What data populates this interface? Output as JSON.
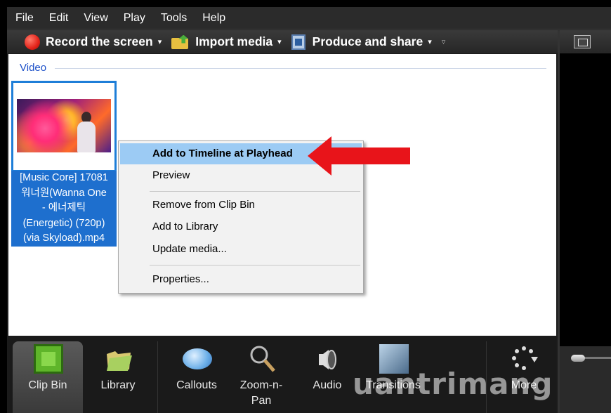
{
  "menubar": {
    "items": [
      "File",
      "Edit",
      "View",
      "Play",
      "Tools",
      "Help"
    ]
  },
  "toolbar": {
    "record_label": "Record the screen",
    "import_label": "Import media",
    "produce_label": "Produce and share",
    "caret": "▾",
    "more_caret": "▿"
  },
  "bin": {
    "section_title": "Video",
    "clip": {
      "label_lines": [
        "[Music Core] 17081",
        "워너원(Wanna One",
        "- 에너제틱",
        "(Energetic) (720p)",
        "(via Skyload).mp4"
      ]
    }
  },
  "context_menu": {
    "items": [
      "Add to Timeline at Playhead",
      "Preview",
      "Remove from Clip Bin",
      "Add to Library",
      "Update media...",
      "Properties..."
    ]
  },
  "tabs": {
    "items": [
      "Clip Bin",
      "Library",
      "Callouts",
      "Zoom-n-\nPan",
      "Audio",
      "Transitions",
      "More"
    ]
  },
  "watermark": "uantrimang",
  "colors": {
    "highlight": "#9ccbf4",
    "selection": "#1e6fce",
    "arrow": "#e8141a",
    "record": "#e2231a"
  }
}
